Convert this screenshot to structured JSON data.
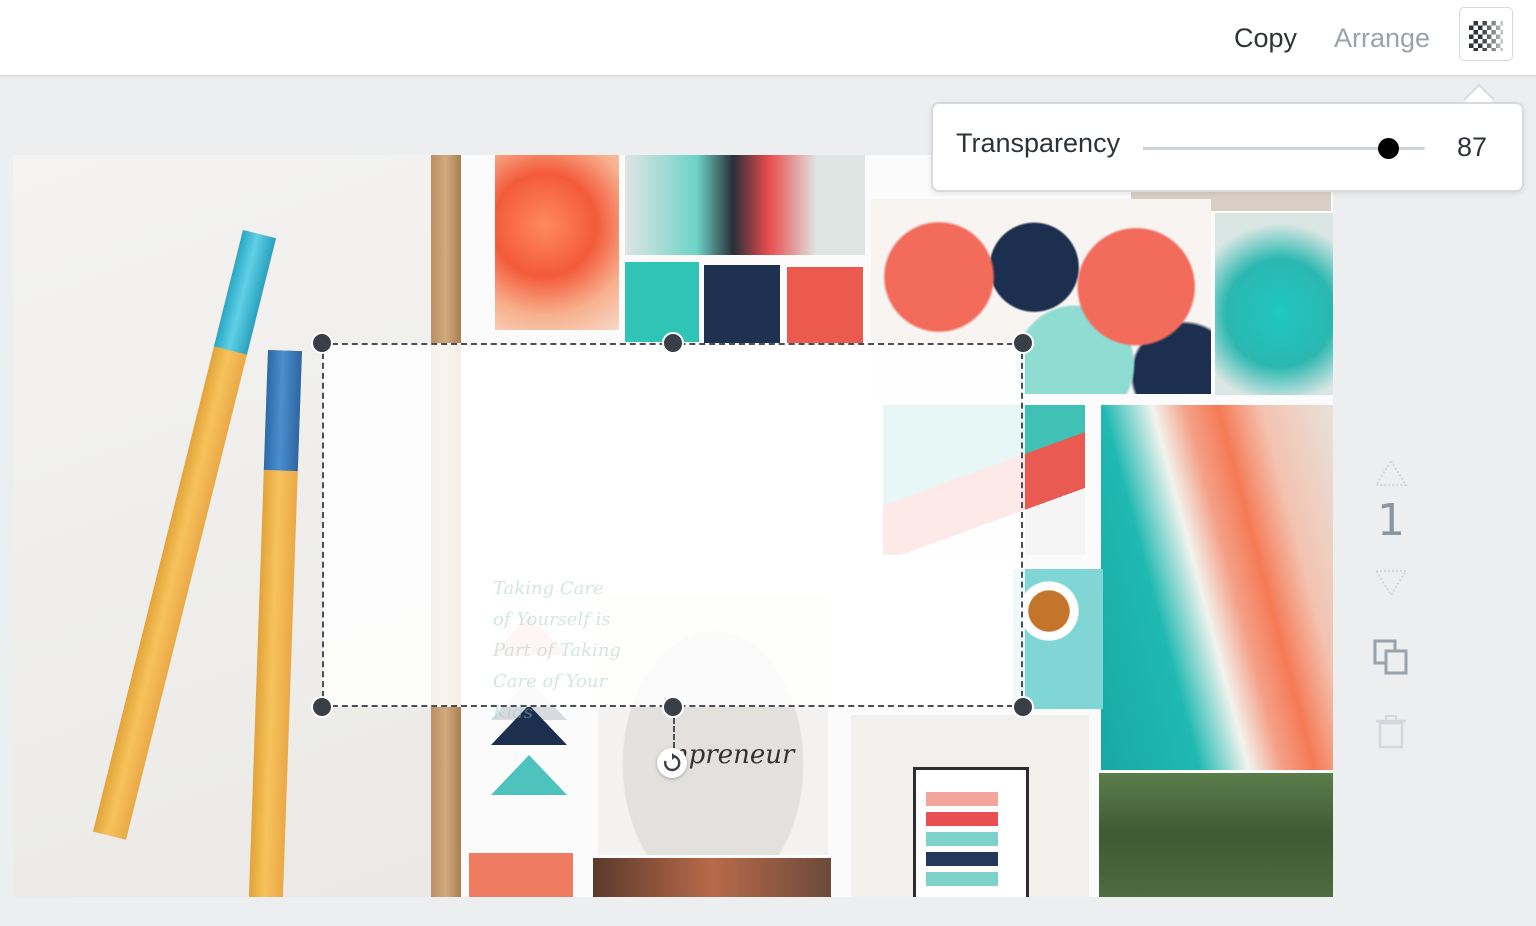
{
  "toolbar": {
    "copy_label": "Copy",
    "arrange_label": "Arrange",
    "transparency_button_icon": "checkerboard-icon"
  },
  "transparency_popover": {
    "label": "Transparency",
    "value": "87",
    "value_percent": 87
  },
  "canvas": {
    "shirt_text": "mpreneur",
    "faded_quote": "Taking Care of Yourself is Part of Taking Care of Your Kids"
  },
  "page_controls": {
    "page_number": "1",
    "move_up_icon": "chevron-up-icon",
    "move_down_icon": "chevron-down-icon",
    "duplicate_icon": "duplicate-icon",
    "delete_icon": "trash-icon"
  },
  "colors": {
    "toolbar_bg": "#ffffff",
    "workspace_bg": "#eceef0",
    "text_dark": "#2e3338",
    "text_muted": "#9aa3ab",
    "slider_knob": "#000000",
    "handle": "#3a3f47"
  }
}
